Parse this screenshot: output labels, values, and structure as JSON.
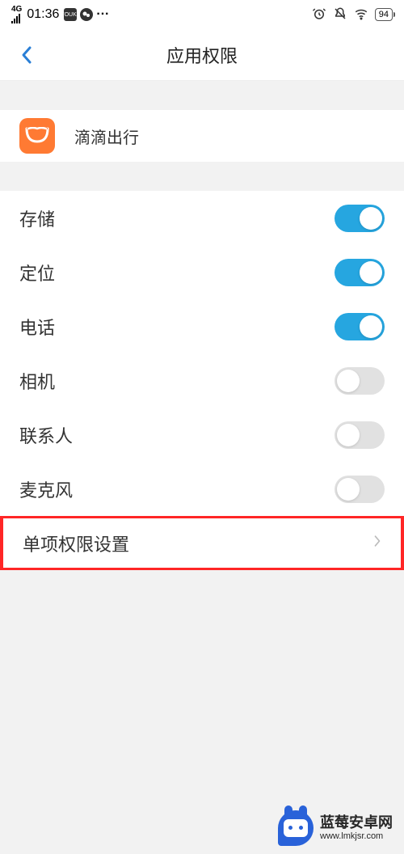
{
  "status": {
    "network": "4G",
    "time": "01:36",
    "dots": "···",
    "battery": "94"
  },
  "header": {
    "title": "应用权限"
  },
  "app": {
    "name": "滴滴出行"
  },
  "permissions": [
    {
      "label": "存储",
      "enabled": true
    },
    {
      "label": "定位",
      "enabled": true
    },
    {
      "label": "电话",
      "enabled": true
    },
    {
      "label": "相机",
      "enabled": false
    },
    {
      "label": "联系人",
      "enabled": false
    },
    {
      "label": "麦克风",
      "enabled": false
    }
  ],
  "nav": {
    "single_permission": "单项权限设置"
  },
  "watermark": {
    "title": "蓝莓安卓网",
    "url": "www.lmkjsr.com"
  },
  "colors": {
    "accent": "#26a6e0",
    "highlight": "#ff2626",
    "app_brand": "#ff7a33"
  }
}
